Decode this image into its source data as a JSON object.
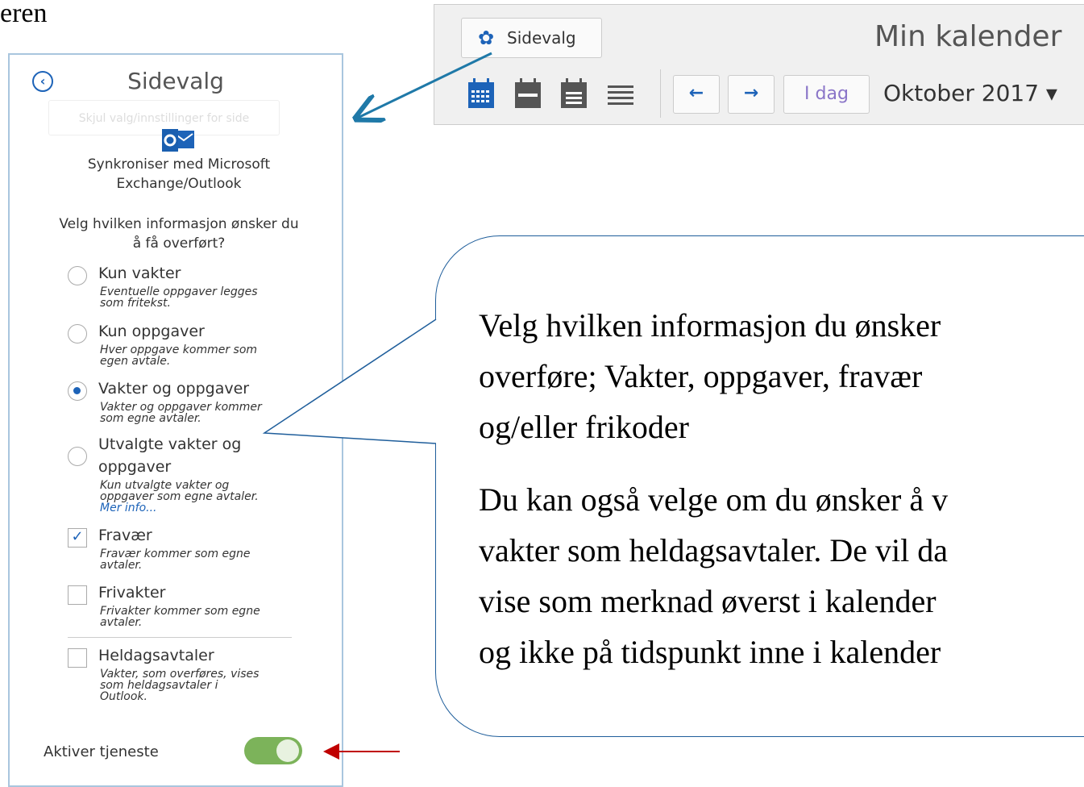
{
  "top_fragment": "eren",
  "panel": {
    "title": "Sidevalg",
    "hide_button": "Skjul valg/innstillinger for side",
    "sync_text_line1": "Synkroniser med Microsoft",
    "sync_text_line2": "Exchange/Outlook",
    "question_line1": "Velg hvilken informasjon ønsker du",
    "question_line2": "å få overført?",
    "options": [
      {
        "label": "Kun vakter",
        "desc1": "Eventuelle oppgaver legges",
        "desc2": "som fritekst.",
        "selected": false
      },
      {
        "label": "Kun oppgaver",
        "desc1": "Hver oppgave kommer som",
        "desc2": "egen avtale.",
        "selected": false
      },
      {
        "label": "Vakter og oppgaver",
        "desc1": "Vakter og oppgaver kommer",
        "desc2": "som egne avtaler.",
        "selected": true
      },
      {
        "label_line1": "Utvalgte vakter og",
        "label_line2": "oppgaver",
        "desc1": "Kun utvalgte vakter og",
        "desc2": "oppgaver som egne avtaler.",
        "link": "Mer info...",
        "selected": false
      }
    ],
    "checkboxes": [
      {
        "label": "Fravær",
        "desc1": "Fravær kommer som egne",
        "desc2": "avtaler.",
        "checked": true
      },
      {
        "label": "Frivakter",
        "desc1": "Frivakter kommer som egne",
        "desc2": "avtaler.",
        "checked": false
      },
      {
        "label": "Heldagsavtaler",
        "desc1": "Vakter, som overføres, vises",
        "desc2": "som heldagsavtaler i",
        "desc3": "Outlook.",
        "checked": false
      }
    ],
    "activate_label": "Aktiver tjeneste",
    "activate_on": true
  },
  "toolbar": {
    "sidevalg_label": "Sidevalg",
    "title": "Min kalender",
    "today_label": "I dag",
    "month_label": "Oktober 2017 ▾",
    "prev_glyph": "←",
    "next_glyph": "→"
  },
  "callout": {
    "line1": "Velg hvilken informasjon du ønsker",
    "line2": "overføre;  Vakter,  oppgaver,  fravær",
    "line3": "og/eller frikoder",
    "line4": "Du kan også velge om du ønsker å v",
    "line5": "vakter som heldagsavtaler.  De vil da",
    "line6": "vise som merknad øverst i kalender",
    "line7": "og ikke på tidspunkt inne i kalender"
  },
  "colors": {
    "accent": "#1d63b8",
    "toggle_on": "#7cb35a",
    "arrow_blue": "#1f79a8",
    "arrow_red": "#c00000",
    "callout_border": "#1f5e9b"
  }
}
